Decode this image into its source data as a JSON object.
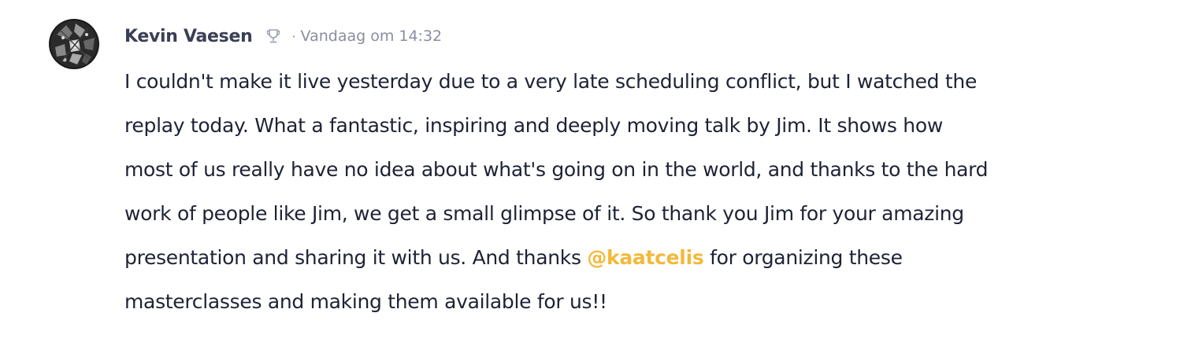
{
  "comment": {
    "author": "Kevin Vaesen",
    "badge_icon": "trophy-icon",
    "separator": "·",
    "timestamp": "Vandaag om 14:32",
    "avatar_icon": "user-avatar",
    "body": {
      "line1": "I couldn't make it live yesterday due to a very late scheduling conflict, but I watched the",
      "line2": "replay today. What a fantastic, inspiring and deeply moving talk by Jim. It shows how",
      "line3": "most of us really have no idea about what's going on in the world, and thanks to the hard",
      "line4": "work of people like Jim, we get a small glimpse of it. So thank you Jim for your amazing",
      "line5_before": "presentation and sharing it with us. And thanks ",
      "mention": "@kaatcelis",
      "line5_after": " for organizing these",
      "line6": "masterclasses and making them available for us!!"
    },
    "colors": {
      "mention": "#f2b93b",
      "text": "#1e2235",
      "meta": "#8a8ea0"
    }
  }
}
